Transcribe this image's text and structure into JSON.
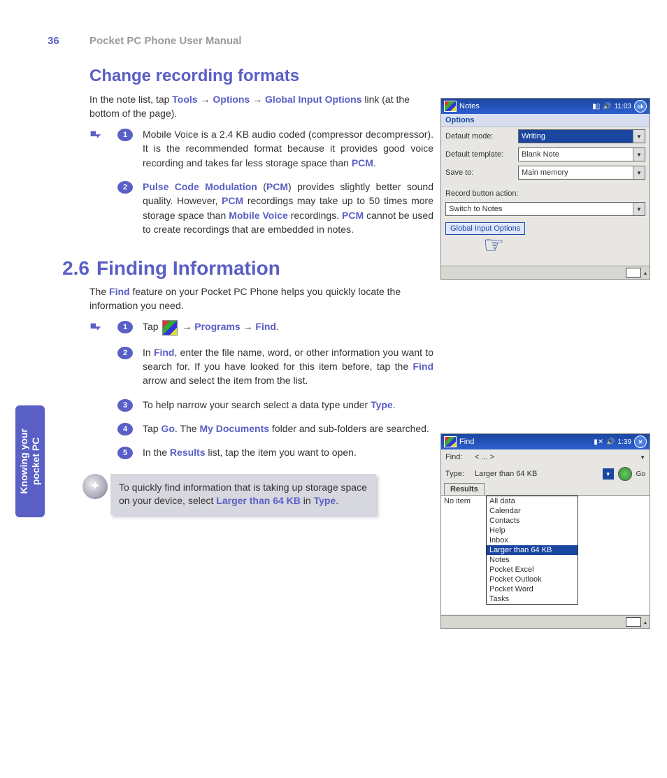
{
  "header": {
    "page_number": "36",
    "title": "Pocket PC Phone User Manual"
  },
  "side_tab": {
    "line1": "Knowing your",
    "line2": "pocket PC"
  },
  "section1": {
    "heading": "Change recording formats",
    "intro_pre": "In the note list, tap ",
    "path1": "Tools",
    "arrow": " → ",
    "path2": "Options",
    "path3": "Global Input Options",
    "intro_post": " link (at the bottom of the page).",
    "steps": [
      {
        "n": "1",
        "pre": "Mobile Voice is a 2.4 KB audio coded (compressor decompressor). It is the recommended format because it provides good voice recording and takes far less storage space than ",
        "k1": "PCM",
        "post": "."
      },
      {
        "n": "2",
        "k1": "Pulse Code Modulation",
        "mid1": " (",
        "k2": "PCM",
        "mid2": ") provides slightly better sound quality. However, ",
        "k3": "PCM",
        "mid3": " recordings may take up to 50 times more storage space than ",
        "k4": "Mobile Voice",
        "mid4": " recordings. ",
        "k5": "PCM",
        "post": " cannot be used to create recordings that are embedded in notes."
      }
    ]
  },
  "section2": {
    "num": "2.6",
    "heading": "Finding Information",
    "intro_pre": "The ",
    "intro_k": "Find",
    "intro_post": " feature on your Pocket PC Phone helps you quickly locate the information you need.",
    "steps": [
      {
        "n": "1",
        "pre": "Tap ",
        "arrow": " → ",
        "k1": "Programs",
        "k2": "Find",
        "post": "."
      },
      {
        "n": "2",
        "pre": "In ",
        "k1": "Find",
        "mid1": ", enter the file name, word, or other information you want to search for. If you have looked for this item before, tap the ",
        "k2": "Find",
        "post": " arrow and select the item from the list."
      },
      {
        "n": "3",
        "pre": "To help narrow your search select a data type under ",
        "k1": "Type",
        "post": "."
      },
      {
        "n": "4",
        "pre": "Tap ",
        "k1": "Go",
        "mid1": ". The ",
        "k2": "My Documents",
        "post": " folder and sub-folders are searched."
      },
      {
        "n": "5",
        "pre": "In the ",
        "k1": "Results",
        "post": " list, tap the item you want to open."
      }
    ],
    "tip": {
      "pre": "To quickly find information that is taking up storage space on your device, select ",
      "k1": "Larger than 64 KB",
      "mid": " in ",
      "k2": "Type",
      "post": "."
    }
  },
  "shot1": {
    "app": "Notes",
    "time": "11:03",
    "ok": "ok",
    "subtitle": "Options",
    "rows": [
      {
        "label": "Default mode:",
        "value": "Writing",
        "selected": true
      },
      {
        "label": "Default template:",
        "value": "Blank Note",
        "selected": false
      },
      {
        "label": "Save to:",
        "value": "Main memory",
        "selected": false
      }
    ],
    "rec_label": "Record button action:",
    "rec_value": "Switch to Notes",
    "link": "Global Input Options"
  },
  "shot2": {
    "app": "Find",
    "time": "1:39",
    "find_label": "Find:",
    "find_value": "< ... >",
    "type_label": "Type:",
    "type_value": "Larger than 64 KB",
    "go": "Go",
    "results_tab": "Results",
    "noitem": "No item",
    "options": [
      "All data",
      "Calendar",
      "Contacts",
      "Help",
      "Inbox",
      "Larger than 64 KB",
      "Notes",
      "Pocket Excel",
      "Pocket Outlook",
      "Pocket Word",
      "Tasks"
    ]
  }
}
